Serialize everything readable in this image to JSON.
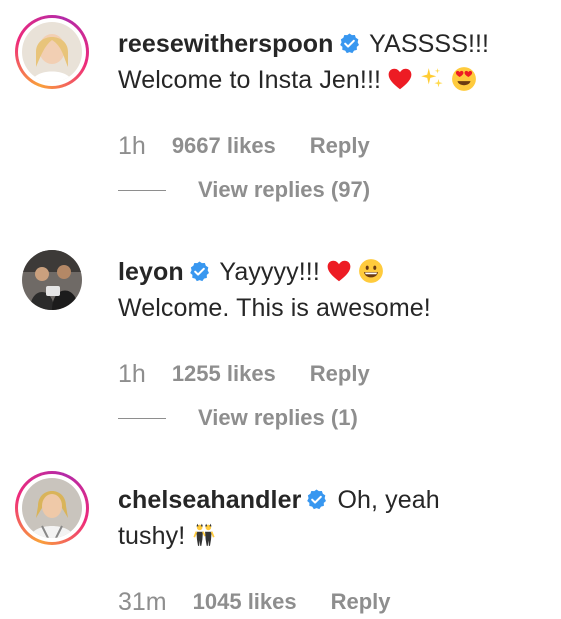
{
  "comments": [
    {
      "username": "reesewitherspoon",
      "verified": true,
      "text_line1": "YASSSS!!!",
      "text_line2": "Welcome to Insta Jen!!!",
      "emojis": [
        "red-heart",
        "sparkles",
        "heart-eyes"
      ],
      "time": "1h",
      "likes": "9667 likes",
      "reply": "Reply",
      "view_replies": "View replies (97)",
      "story_ring": true
    },
    {
      "username": "leyon",
      "verified": true,
      "text_line1": "Yayyyy!!!",
      "text_line2": "Welcome. This is awesome!",
      "emojis": [
        "red-heart",
        "grinning-face"
      ],
      "time": "1h",
      "likes": "1255 likes",
      "reply": "Reply",
      "view_replies": "View replies (1)",
      "story_ring": false
    },
    {
      "username": "chelseahandler",
      "verified": true,
      "text_line1": "Oh, yeah",
      "text_line2": "tushy!",
      "emojis": [
        "dancers"
      ],
      "time": "31m",
      "likes": "1045 likes",
      "reply": "Reply",
      "story_ring": true
    }
  ],
  "colors": {
    "text_primary": "#262626",
    "text_secondary": "#8e8e8e",
    "verified_blue": "#3897f0",
    "heart_red": "#ed1c24"
  }
}
